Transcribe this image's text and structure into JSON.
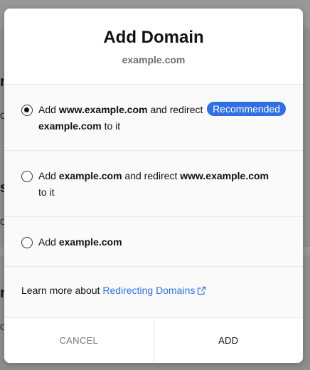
{
  "modal": {
    "title": "Add Domain",
    "subtitle": "example.com"
  },
  "options": [
    {
      "selected": true,
      "parts": [
        "Add ",
        "www.example.com",
        " and redirect ",
        "example.com",
        " to it"
      ],
      "badge": "Recommended"
    },
    {
      "selected": false,
      "parts": [
        "Add ",
        "example.com",
        " and redirect ",
        "www.example.com",
        " to it"
      ]
    },
    {
      "selected": false,
      "parts": [
        "Add ",
        "example.com"
      ]
    }
  ],
  "learn_more": {
    "prefix": "Learn more about ",
    "link_text": "Redirecting Domains",
    "icon": "external-link-icon"
  },
  "footer": {
    "cancel_label": "CANCEL",
    "add_label": "ADD"
  },
  "colors": {
    "accent": "#2f6fe0",
    "overlay": "#8e8e8e"
  }
}
